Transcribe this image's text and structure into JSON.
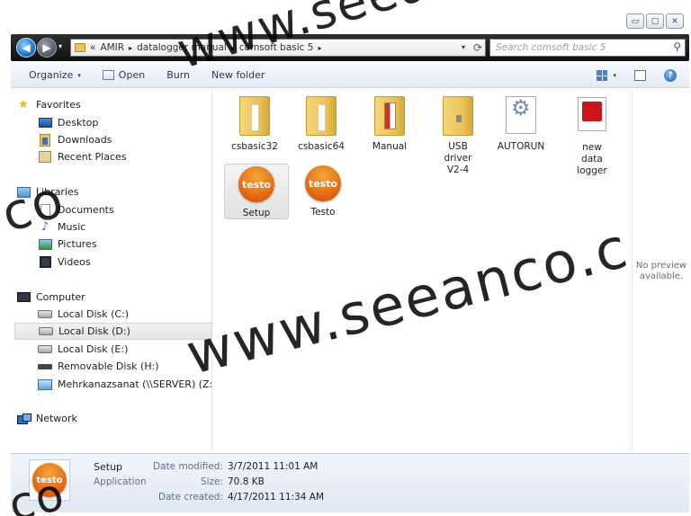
{
  "window": {
    "min_glyph": "▭",
    "max_glyph": "▢",
    "close_glyph": "✕"
  },
  "nav": {
    "back_glyph": "◀",
    "forward_glyph": "▶",
    "recent_glyph": "▾",
    "address_prefix": "«",
    "breadcrumbs": [
      "AMIR",
      "datalogger manual",
      "comsoft basic 5"
    ],
    "crumb_sep": "▸",
    "dropdown_glyph": "▾",
    "refresh_glyph": "⟳",
    "search_placeholder": "Search comsoft basic 5",
    "search_glyph": "⚲"
  },
  "toolbar": {
    "organize": "Organize",
    "dropdown_glyph": "▾",
    "open": "Open",
    "burn": "Burn",
    "new_folder": "New folder",
    "help_glyph": "?"
  },
  "sidebar": {
    "favorites": {
      "label": "Favorites",
      "items": [
        "Desktop",
        "Downloads",
        "Recent Places"
      ]
    },
    "libraries": {
      "label": "Libraries",
      "items": [
        "Documents",
        "Music",
        "Pictures",
        "Videos"
      ]
    },
    "computer": {
      "label": "Computer",
      "items": [
        "Local Disk (C:)",
        "Local Disk (D:)",
        "Local Disk (E:)",
        "Removable Disk (H:)",
        "Mehrkanazsanat (\\\\SERVER) (Z:)"
      ]
    },
    "network": {
      "label": "Network"
    },
    "selected_item": "Local Disk (D:)"
  },
  "files": [
    {
      "name": "csbasic32",
      "kind": "folder"
    },
    {
      "name": "csbasic64",
      "kind": "folder"
    },
    {
      "name": "Manual",
      "kind": "folder"
    },
    {
      "name": "USB driver V2-4",
      "kind": "folder"
    },
    {
      "name": "AUTORUN",
      "kind": "settings"
    },
    {
      "name": "new data logger",
      "kind": "pdf"
    },
    {
      "name": "Setup",
      "kind": "app",
      "selected": true
    },
    {
      "name": "Testo",
      "kind": "app"
    }
  ],
  "testo_logo_text": "testo",
  "preview": {
    "text": "No preview available."
  },
  "details": {
    "name": "Setup",
    "type": "Application",
    "modified_label": "Date modified:",
    "modified_value": "3/7/2011 11:01 AM",
    "size_label": "Size:",
    "size_value": "70.8 KB",
    "created_label": "Date created:",
    "created_value": "4/17/2011 11:34 AM"
  },
  "watermark": {
    "text_top": "www.seea",
    "text_mid": "www.seeanco.c",
    "text_left": "co",
    "text_bottom": "co"
  }
}
